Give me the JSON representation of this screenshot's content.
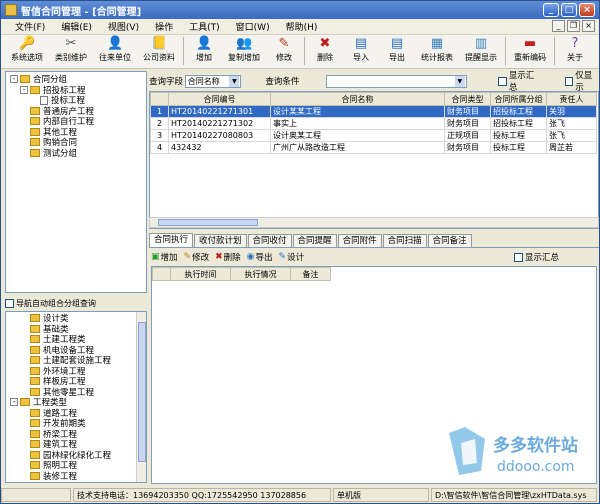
{
  "window": {
    "title": "智信合同管理 - [合同管理]"
  },
  "menu": [
    "文件(F)",
    "编辑(E)",
    "视图(V)",
    "操作",
    "工具(T)",
    "窗口(W)",
    "帮助(H)"
  ],
  "toolbar": [
    {
      "label": "系统选项",
      "icon": "key-icon",
      "glyph": "🔑",
      "color": "#c8a020"
    },
    {
      "label": "类别维护",
      "icon": "tools-icon",
      "glyph": "✂",
      "color": "#555"
    },
    {
      "label": "往来单位",
      "icon": "user-icon",
      "glyph": "👤",
      "color": "#2a60b0"
    },
    {
      "label": "公司资料",
      "icon": "book-icon",
      "glyph": "📒",
      "color": "#b08020"
    },
    {
      "label": "增加",
      "icon": "add-user-icon",
      "glyph": "👤",
      "color": "#2a60b0"
    },
    {
      "label": "复制增加",
      "icon": "copy-add-icon",
      "glyph": "👥",
      "color": "#2a60b0"
    },
    {
      "label": "修改",
      "icon": "pencil-icon",
      "glyph": "✎",
      "color": "#c03020"
    },
    {
      "label": "删除",
      "icon": "delete-icon",
      "glyph": "✖",
      "color": "#c01818"
    },
    {
      "label": "导入",
      "icon": "import-icon",
      "glyph": "▤",
      "color": "#2a70c0"
    },
    {
      "label": "导出",
      "icon": "export-icon",
      "glyph": "▤",
      "color": "#2a70c0"
    },
    {
      "label": "统计报表",
      "icon": "report-icon",
      "glyph": "▦",
      "color": "#3a80c0"
    },
    {
      "label": "提醒显示",
      "icon": "reminder-icon",
      "glyph": "▥",
      "color": "#3a80c0"
    },
    {
      "label": "重新编码",
      "icon": "recode-icon",
      "glyph": "▬",
      "color": "#c02020"
    },
    {
      "label": "关于",
      "icon": "help-icon",
      "glyph": "?",
      "color": "#7040b0"
    }
  ],
  "tree_top": [
    {
      "level": 0,
      "toggle": "-",
      "label": "合同分组",
      "kind": "fold"
    },
    {
      "level": 1,
      "toggle": "-",
      "label": "招投标工程",
      "kind": "fold"
    },
    {
      "level": 2,
      "toggle": "",
      "label": "投标工程",
      "kind": "doc"
    },
    {
      "level": 1,
      "toggle": "",
      "label": "普通房产工程",
      "kind": "fold"
    },
    {
      "level": 1,
      "toggle": "",
      "label": "内部自行工程",
      "kind": "fold"
    },
    {
      "level": 1,
      "toggle": "",
      "label": "其他工程",
      "kind": "fold"
    },
    {
      "level": 1,
      "toggle": "",
      "label": "购销合同",
      "kind": "fold"
    },
    {
      "level": 1,
      "toggle": "",
      "label": "测试分组",
      "kind": "fold"
    }
  ],
  "nav_checkbox_label": "导航自动组合分组查询",
  "tree_bottom": [
    {
      "level": 1,
      "toggle": "",
      "label": "设计类",
      "kind": "fold"
    },
    {
      "level": 1,
      "toggle": "",
      "label": "基础类",
      "kind": "fold"
    },
    {
      "level": 1,
      "toggle": "",
      "label": "土建工程类",
      "kind": "fold"
    },
    {
      "level": 1,
      "toggle": "",
      "label": "机电设备工程",
      "kind": "fold"
    },
    {
      "level": 1,
      "toggle": "",
      "label": "土建配套设施工程",
      "kind": "fold"
    },
    {
      "level": 1,
      "toggle": "",
      "label": "外环境工程",
      "kind": "fold"
    },
    {
      "level": 1,
      "toggle": "",
      "label": "样板房工程",
      "kind": "fold"
    },
    {
      "level": 1,
      "toggle": "",
      "label": "其他零星工程",
      "kind": "fold"
    },
    {
      "level": 0,
      "toggle": "-",
      "label": "工程类型",
      "kind": "fold"
    },
    {
      "level": 1,
      "toggle": "",
      "label": "道路工程",
      "kind": "fold"
    },
    {
      "level": 1,
      "toggle": "",
      "label": "开发前期类",
      "kind": "fold"
    },
    {
      "level": 1,
      "toggle": "",
      "label": "桥梁工程",
      "kind": "fold"
    },
    {
      "level": 1,
      "toggle": "",
      "label": "建筑工程",
      "kind": "fold"
    },
    {
      "level": 1,
      "toggle": "",
      "label": "园林绿化绿化工程",
      "kind": "fold"
    },
    {
      "level": 1,
      "toggle": "",
      "label": "照明工程",
      "kind": "fold"
    },
    {
      "level": 1,
      "toggle": "",
      "label": "装修工程",
      "kind": "fold"
    }
  ],
  "search": {
    "field_label": "查询字段",
    "field_value": "合同名称",
    "cond_label": "查询条件",
    "cond_value": "",
    "summary_label": "显示汇总",
    "only_label": "仅显示"
  },
  "table": {
    "headers": [
      "",
      "合同编号",
      "合同名称",
      "合同类型",
      "合同所属分组",
      "责任人"
    ],
    "rows": [
      [
        "1",
        "HT20140221271301",
        "设计某某工程",
        "财务项目",
        "招投标工程",
        "关羽"
      ],
      [
        "2",
        "HT20140221271302",
        "事实上",
        "财务项目",
        "招投标工程",
        "张飞"
      ],
      [
        "3",
        "HT20140227080803",
        "设计奥某工程",
        "正规项目",
        "投标工程",
        "张飞"
      ],
      [
        "4",
        "432432",
        "广州广从路改造工程",
        "财务项目",
        "投标工程",
        "周芷若"
      ]
    ]
  },
  "tabs": [
    "合同执行",
    "收付款计划",
    "合同收付",
    "合同提醒",
    "合同附件",
    "合同扫描",
    "合同备注"
  ],
  "subtoolbar": [
    {
      "label": "增加",
      "icon": "add-icon",
      "glyph": "▣",
      "color": "#2a9a2a"
    },
    {
      "label": "修改",
      "icon": "edit-icon",
      "glyph": "✎",
      "color": "#c08010"
    },
    {
      "label": "删除",
      "icon": "delete-icon",
      "glyph": "✖",
      "color": "#c01818"
    },
    {
      "label": "导出",
      "icon": "export-icon",
      "glyph": "◉",
      "color": "#2a70c0"
    },
    {
      "label": "设计",
      "icon": "design-icon",
      "glyph": "✎",
      "color": "#2a70c0"
    }
  ],
  "sub_summary_label": "显示汇总",
  "subtable_headers": [
    "",
    "执行时间",
    "执行情况",
    "备注"
  ],
  "status": {
    "support": "技术支持电话：13694203350 QQ:1725542950 137028856",
    "mode": "单机版",
    "path": "D:\\智信软件\\智信合同管理\\zxHTData.sys"
  },
  "watermark": {
    "brand": "多多软件站",
    "domain": "ddooo.com"
  }
}
